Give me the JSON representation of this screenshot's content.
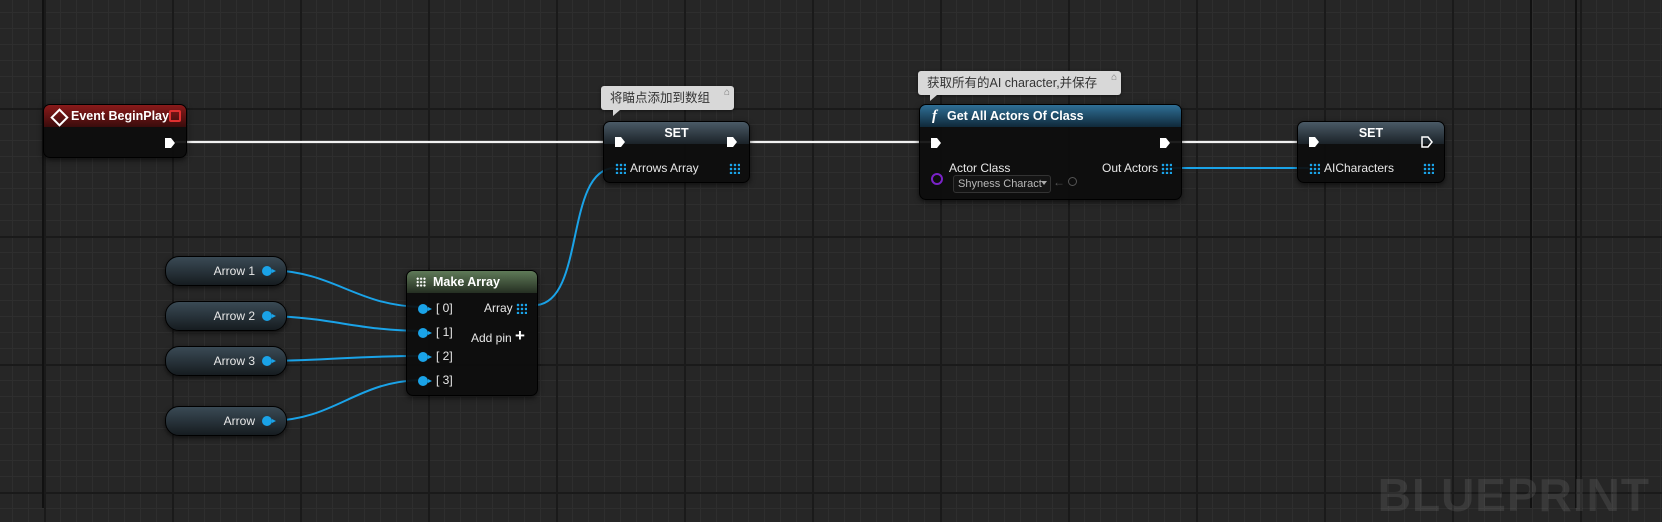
{
  "canvas": {
    "watermark": "BLUEPRINT"
  },
  "nodes": {
    "event_begin_play": {
      "title": "Event BeginPlay"
    },
    "set_arrows": {
      "title": "SET",
      "var_label": "Arrows Array"
    },
    "get_all_actors": {
      "title": "Get All Actors Of Class",
      "function_glyph": "f",
      "input_label": "Actor Class",
      "class_value": "Shyness Charact",
      "output_label": "Out Actors"
    },
    "set_ai": {
      "title": "SET",
      "var_label": "AICharacters"
    },
    "make_array": {
      "title": "Make Array",
      "output_label": "Array",
      "inputs": [
        "[ 0]",
        "[ 1]",
        "[ 2]",
        "[ 3]"
      ],
      "add_pin_label": "Add pin",
      "add_pin_symbol": "+"
    },
    "arrow_vars": [
      "Arrow 1",
      "Arrow 2",
      "Arrow 3",
      "Arrow"
    ]
  },
  "comments": {
    "set_arrows": "将瞄点添加到数组",
    "get_all_actors": "获取所有的AI character,并保存"
  },
  "colors": {
    "event_header": "#8a1a1a",
    "function_header": "#2f6f96",
    "make_array_header": "#5f7a58",
    "object_pin": "#1aa3e8",
    "class_pin": "#7a22c8",
    "exec_wire": "#ffffff"
  }
}
